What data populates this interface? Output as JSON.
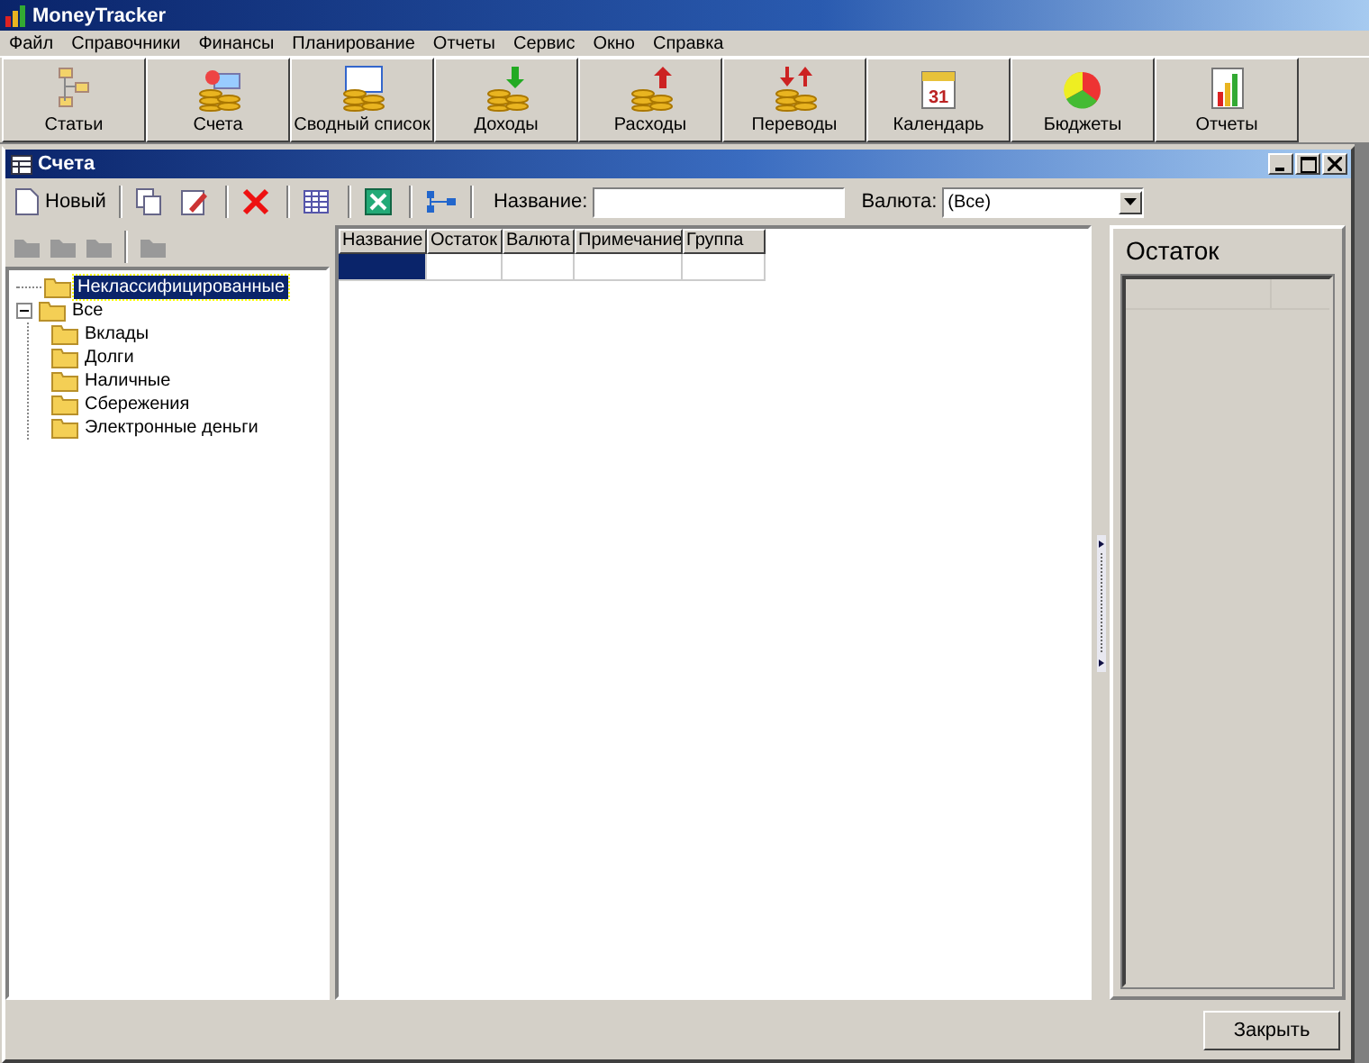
{
  "app_title": "MoneyTracker",
  "menu": [
    "Файл",
    "Справочники",
    "Финансы",
    "Планирование",
    "Отчеты",
    "Сервис",
    "Окно",
    "Справка"
  ],
  "calendar_icon_day": "31",
  "toolbar": [
    "Статьи",
    "Счета",
    "Сводный список",
    "Доходы",
    "Расходы",
    "Переводы",
    "Календарь",
    "Бюджеты",
    "Отчеты"
  ],
  "child_window": {
    "title": "Счета",
    "toolbar": {
      "new_button": "Новый",
      "name_label": "Название:",
      "currency_label": "Валюта:",
      "currency_value": "(Все)"
    },
    "tree": [
      {
        "label": "Неклассифицированные",
        "selected": true
      },
      {
        "label": "Все",
        "selected": false,
        "expanded": true,
        "children": [
          {
            "label": "Вклады",
            "selected": false
          },
          {
            "label": "Долги",
            "selected": false
          },
          {
            "label": "Наличные",
            "selected": false
          },
          {
            "label": "Сбережения",
            "selected": false
          },
          {
            "label": "Электронные деньги",
            "selected": false
          }
        ]
      }
    ],
    "grid": {
      "columns": [
        "Название",
        "Остаток",
        "Валюта",
        "Примечание",
        "Группа"
      ],
      "rows": [
        {
          "selected": true
        }
      ]
    },
    "balance_panel": {
      "title": "Остаток"
    },
    "close_button": "Закрыть"
  }
}
